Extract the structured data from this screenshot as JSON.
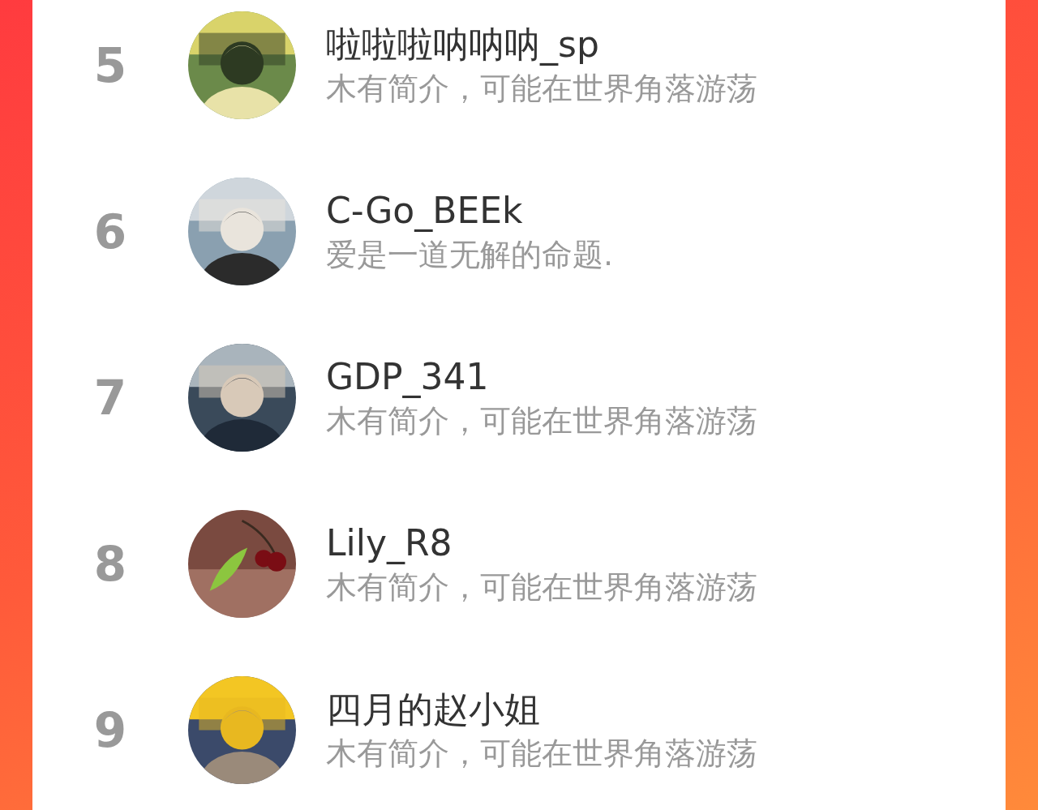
{
  "ranking": [
    {
      "rank": "5",
      "name": "啦啦啦呐呐呐_sp",
      "bio": "木有简介，可能在世界角落游荡"
    },
    {
      "rank": "6",
      "name": "C-Go_BEEk",
      "bio": "爱是一道无解的命题."
    },
    {
      "rank": "7",
      "name": "GDP_341",
      "bio": "木有简介，可能在世界角落游荡"
    },
    {
      "rank": "8",
      "name": "Lily_R8",
      "bio": "木有简介，可能在世界角落游荡"
    },
    {
      "rank": "9",
      "name": "四月的赵小姐",
      "bio": "木有简介，可能在世界角落游荡"
    }
  ]
}
